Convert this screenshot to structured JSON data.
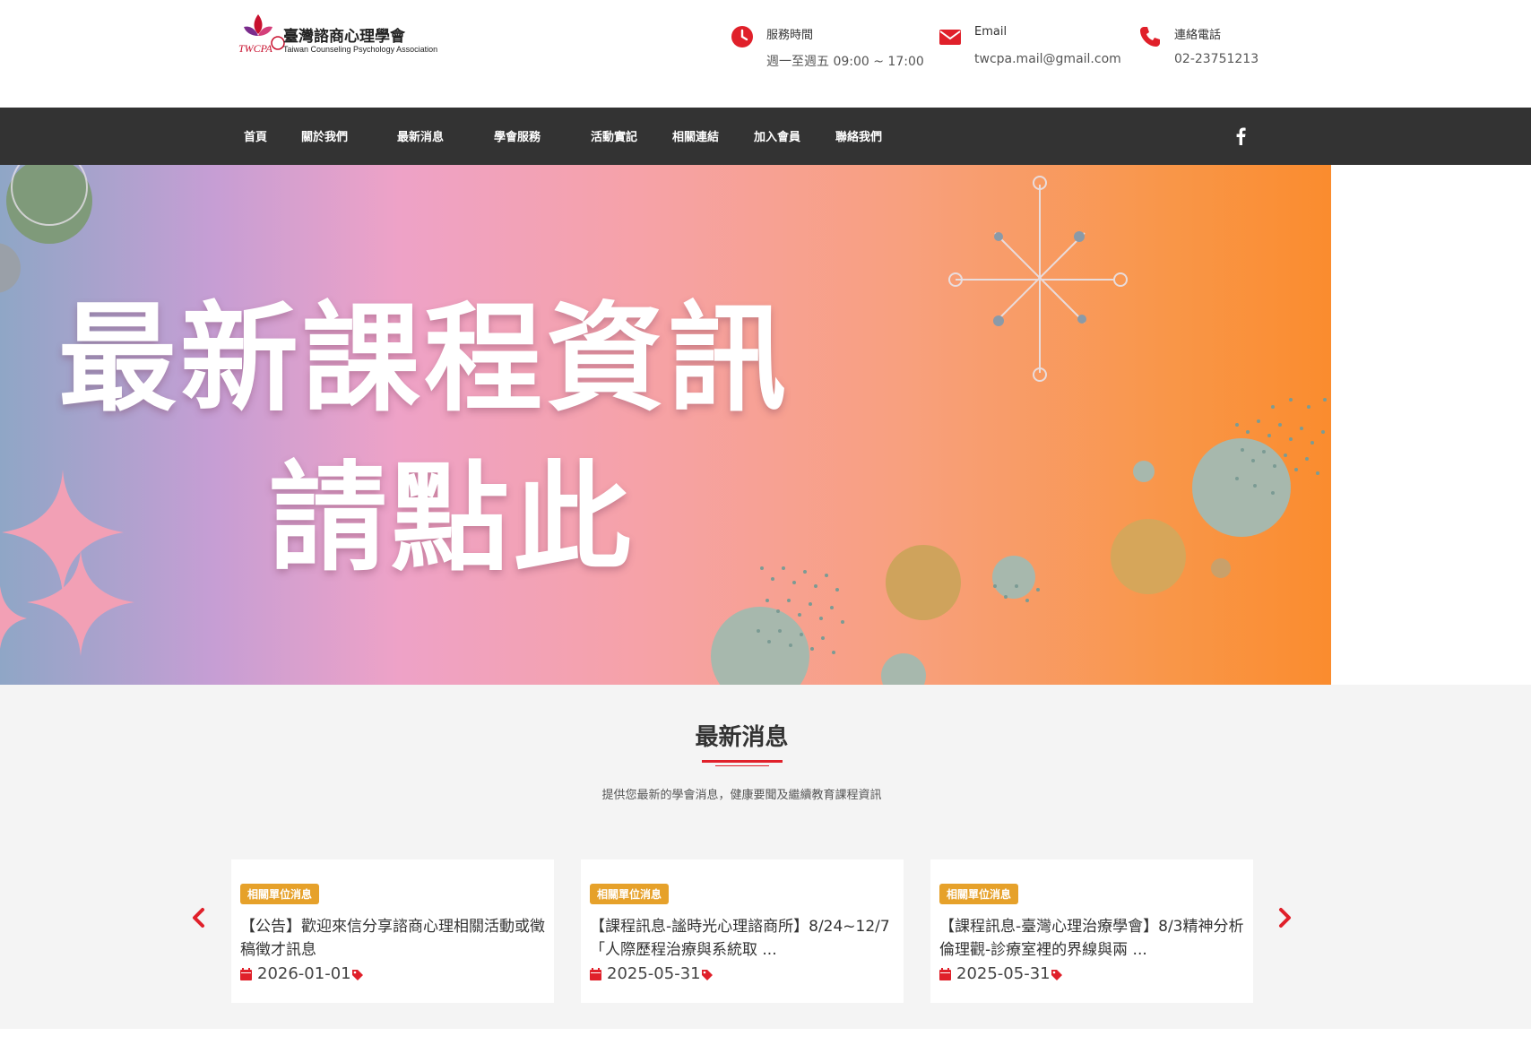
{
  "header": {
    "logo_title": "臺灣諮商心理學會",
    "logo_subtitle": "Taiwan Counseling Psychology Association",
    "contacts": [
      {
        "icon": "clock-icon",
        "label": "服務時間",
        "value": "週一至週五 09:00 ~ 17:00"
      },
      {
        "icon": "envelope-icon",
        "label": "Email",
        "value": "twcpa.mail@gmail.com"
      },
      {
        "icon": "phone-icon",
        "label": "連絡電話",
        "value": "02-23751213"
      }
    ]
  },
  "nav": {
    "items": [
      "首頁",
      "關於我們",
      "最新消息",
      "學會服務",
      "活動實記",
      "相關連結",
      "加入會員",
      "聯絡我們"
    ],
    "social_icon": "facebook-icon"
  },
  "banner": {
    "line1": "最新課程資訊",
    "line2": "請點此"
  },
  "news": {
    "title": "最新消息",
    "subtitle": "提供您最新的學會消息，健康要聞及繼續教育課程資訊",
    "cards": [
      {
        "badge": "相關單位消息",
        "text": "【公告】歡迎來信分享諮商心理相關活動或徵稿徵才訊息",
        "date": "2026-01-01"
      },
      {
        "badge": "相關單位消息",
        "text": "【課程訊息-謐時光心理諮商所】8/24~12/7「人際歷程治療與系統取 ...",
        "date": "2025-05-31"
      },
      {
        "badge": "相關單位消息",
        "text": "【課程訊息-臺灣心理治療學會】8/3精神分析倫理觀-診療室裡的界線與兩 ...",
        "date": "2025-05-31"
      }
    ]
  },
  "colors": {
    "accent": "#e0202a",
    "nav_bg": "#333333",
    "badge": "#e6a12a",
    "news_bg": "#f4f4f4"
  }
}
